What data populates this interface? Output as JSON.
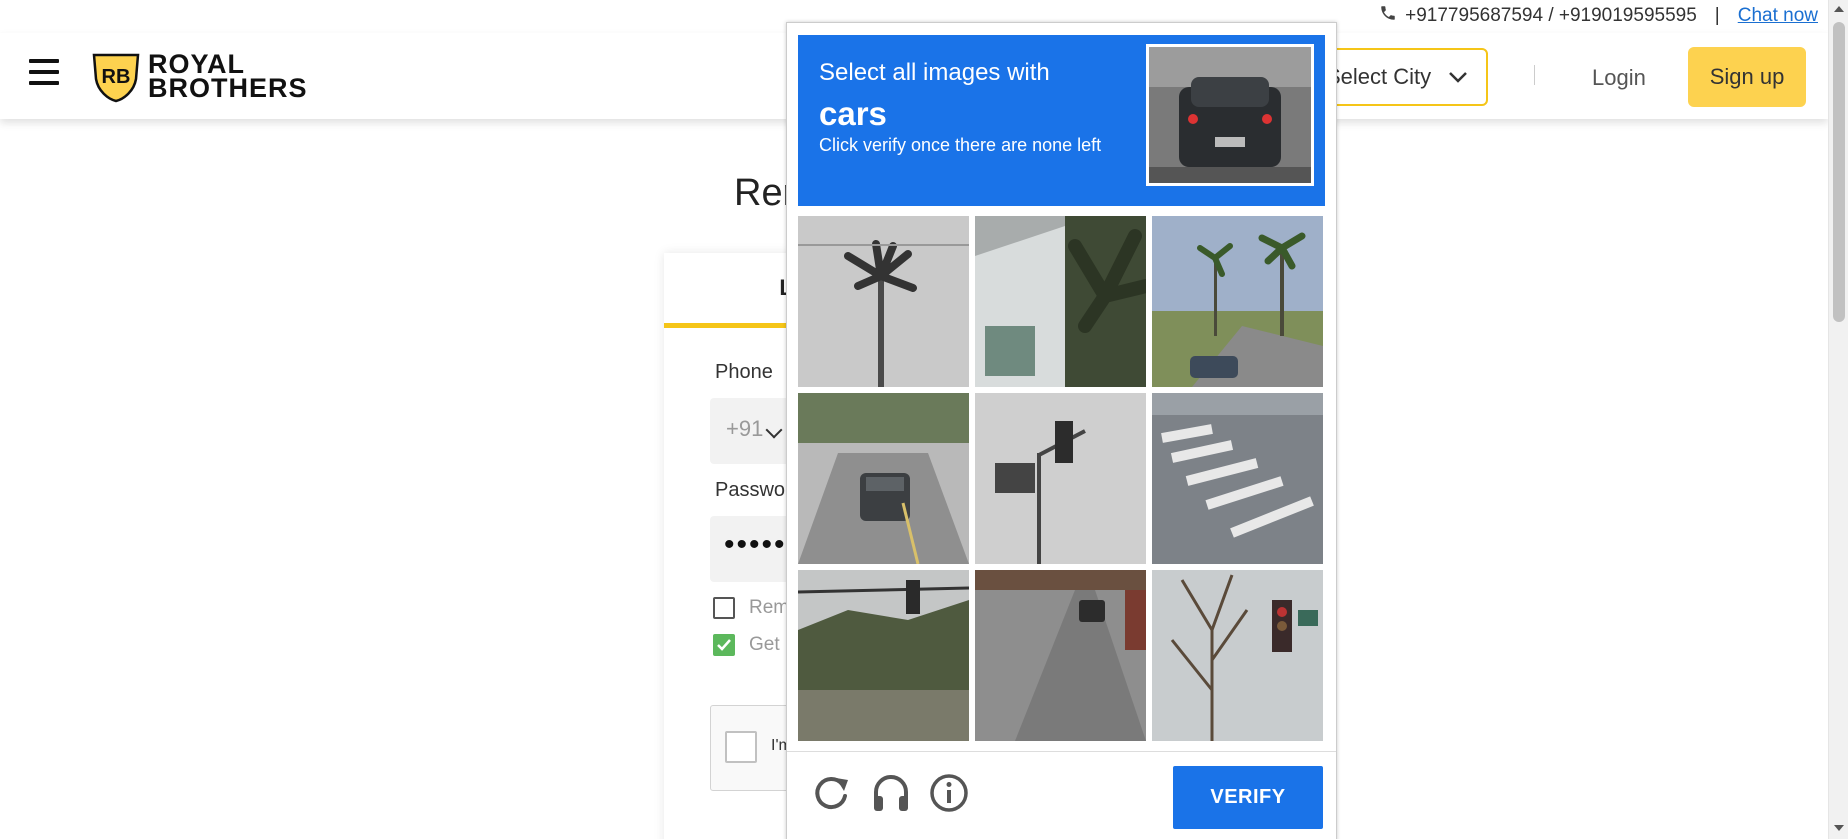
{
  "contact": {
    "phones": "+917795687594 / +919019595595",
    "separator": "|",
    "chat_label": "Chat now"
  },
  "header": {
    "logo_line1": "ROYAL",
    "logo_line2": "BROTHERS",
    "logo_badge": "RB",
    "city_label": "Select City",
    "login_label": "Login",
    "signup_label": "Sign up"
  },
  "main": {
    "heading": "Rer",
    "tab_login": "LOG",
    "phone_label": "Phone",
    "phone_code": "+91",
    "password_label": "Passwo",
    "password_value": "••••••",
    "remember_label": "Rem",
    "get_updates_label": "Get",
    "recaptcha_text": "I'm"
  },
  "captcha": {
    "line1": "Select all images with",
    "object": "cars",
    "line3": "Click verify once there are none left",
    "verify_label": "VERIFY",
    "tiles": [
      "palm-tree",
      "house-palm",
      "street-palms-car",
      "road-car",
      "traffic-light",
      "crosswalk",
      "traffic-light-hills",
      "road-car-distant",
      "tree-traffic-light"
    ]
  },
  "colors": {
    "brand_yellow": "#fdd24f",
    "accent_yellow": "#f5c518",
    "captcha_blue": "#1a73e8",
    "check_green": "#5cb85c",
    "link_blue": "#1a6fd1"
  },
  "icons": [
    "phone-icon",
    "hamburger-icon",
    "chevron-down-icon",
    "reload-icon",
    "headphones-icon",
    "info-icon",
    "check-icon"
  ]
}
